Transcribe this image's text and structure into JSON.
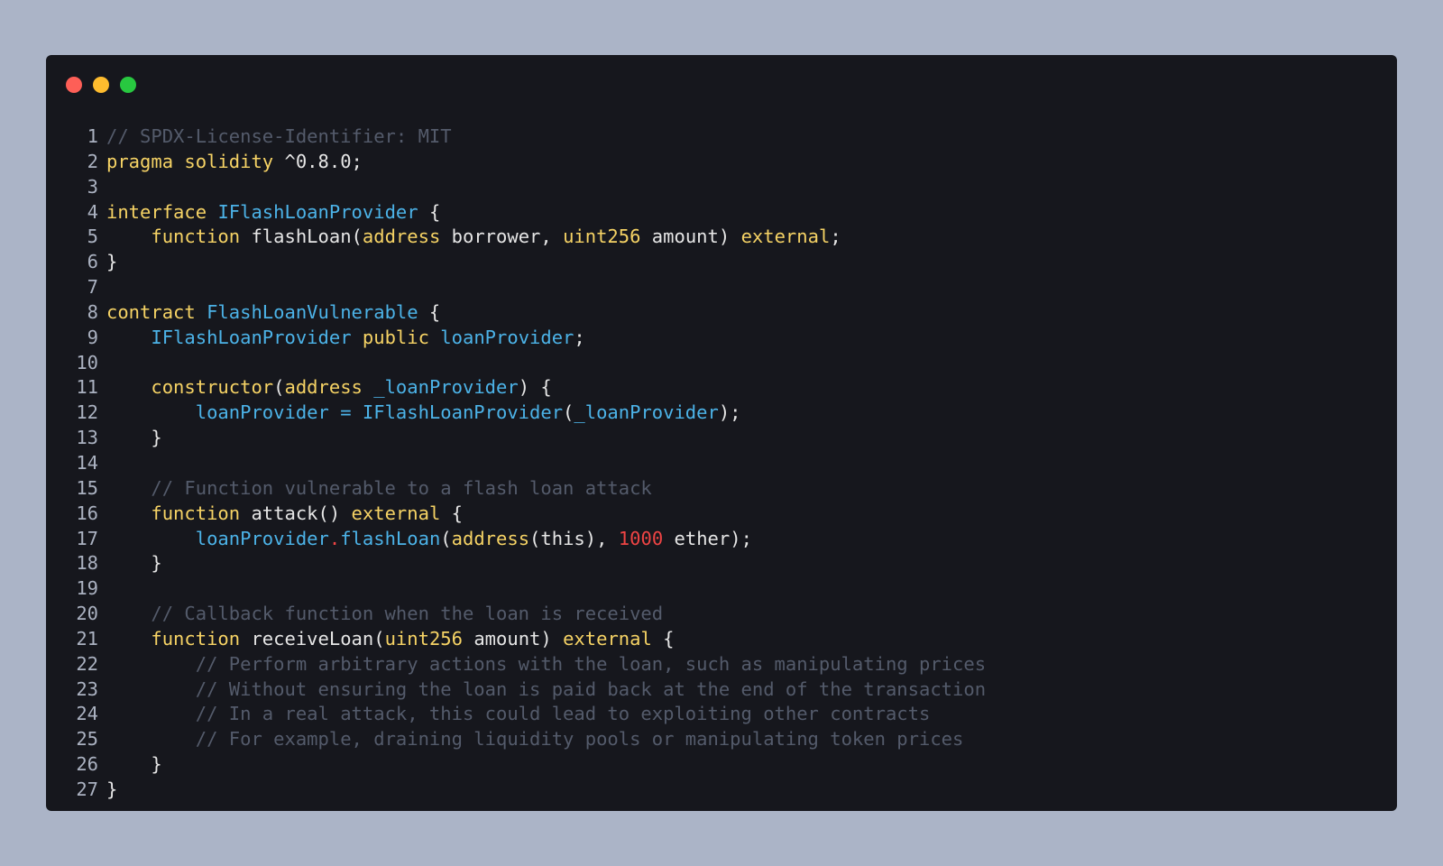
{
  "window": {
    "dots": [
      {
        "name": "close-dot",
        "color": "#fe5f57"
      },
      {
        "name": "minimize-dot",
        "color": "#febc2e"
      },
      {
        "name": "maximize-dot",
        "color": "#28c840"
      }
    ]
  },
  "colors": {
    "background": "#abb4c7",
    "editor_bg": "#16171d",
    "line_number": "#aab1c0",
    "plain": "#e6e6e6",
    "keyword": "#f6d365",
    "type": "#4cb3e8",
    "comment": "#545b6b",
    "number": "#ef4444"
  },
  "code": {
    "language": "solidity",
    "lines": [
      {
        "n": "1",
        "tokens": [
          {
            "t": "comment",
            "v": "// SPDX-License-Identifier: MIT"
          }
        ]
      },
      {
        "n": "2",
        "tokens": [
          {
            "t": "kw",
            "v": "pragma"
          },
          {
            "t": "plain",
            "v": " "
          },
          {
            "t": "kw",
            "v": "solidity"
          },
          {
            "t": "plain",
            "v": " ^0.8.0;"
          }
        ]
      },
      {
        "n": "3",
        "tokens": []
      },
      {
        "n": "4",
        "tokens": [
          {
            "t": "kw",
            "v": "interface"
          },
          {
            "t": "plain",
            "v": " "
          },
          {
            "t": "type",
            "v": "IFlashLoanProvider"
          },
          {
            "t": "plain",
            "v": " {"
          }
        ]
      },
      {
        "n": "5",
        "tokens": [
          {
            "t": "plain",
            "v": "    "
          },
          {
            "t": "kw",
            "v": "function"
          },
          {
            "t": "plain",
            "v": " flashLoan("
          },
          {
            "t": "kw",
            "v": "address"
          },
          {
            "t": "plain",
            "v": " borrower, "
          },
          {
            "t": "kw",
            "v": "uint256"
          },
          {
            "t": "plain",
            "v": " amount) "
          },
          {
            "t": "kw",
            "v": "external"
          },
          {
            "t": "plain",
            "v": ";"
          }
        ]
      },
      {
        "n": "6",
        "tokens": [
          {
            "t": "plain",
            "v": "}"
          }
        ]
      },
      {
        "n": "7",
        "tokens": []
      },
      {
        "n": "8",
        "tokens": [
          {
            "t": "kw",
            "v": "contract"
          },
          {
            "t": "plain",
            "v": " "
          },
          {
            "t": "type",
            "v": "FlashLoanVulnerable"
          },
          {
            "t": "plain",
            "v": " {"
          }
        ]
      },
      {
        "n": "9",
        "tokens": [
          {
            "t": "plain",
            "v": "    "
          },
          {
            "t": "type",
            "v": "IFlashLoanProvider"
          },
          {
            "t": "plain",
            "v": " "
          },
          {
            "t": "kw",
            "v": "public"
          },
          {
            "t": "plain",
            "v": " "
          },
          {
            "t": "type",
            "v": "loanProvider"
          },
          {
            "t": "plain",
            "v": ";"
          }
        ]
      },
      {
        "n": "10",
        "tokens": []
      },
      {
        "n": "11",
        "tokens": [
          {
            "t": "plain",
            "v": "    "
          },
          {
            "t": "kw",
            "v": "constructor"
          },
          {
            "t": "plain",
            "v": "("
          },
          {
            "t": "kw",
            "v": "address"
          },
          {
            "t": "plain",
            "v": " "
          },
          {
            "t": "type",
            "v": "_loanProvider"
          },
          {
            "t": "plain",
            "v": ") {"
          }
        ]
      },
      {
        "n": "12",
        "tokens": [
          {
            "t": "plain",
            "v": "        "
          },
          {
            "t": "type",
            "v": "loanProvider = IFlashLoanProvider"
          },
          {
            "t": "plain",
            "v": "("
          },
          {
            "t": "type",
            "v": "_loanProvider"
          },
          {
            "t": "plain",
            "v": ");"
          }
        ]
      },
      {
        "n": "13",
        "tokens": [
          {
            "t": "plain",
            "v": "    }"
          }
        ]
      },
      {
        "n": "14",
        "tokens": []
      },
      {
        "n": "15",
        "tokens": [
          {
            "t": "plain",
            "v": "    "
          },
          {
            "t": "comment",
            "v": "// Function vulnerable to a flash loan attack"
          }
        ]
      },
      {
        "n": "16",
        "tokens": [
          {
            "t": "plain",
            "v": "    "
          },
          {
            "t": "kw",
            "v": "function"
          },
          {
            "t": "plain",
            "v": " attack() "
          },
          {
            "t": "kw",
            "v": "external"
          },
          {
            "t": "plain",
            "v": " {"
          }
        ]
      },
      {
        "n": "17",
        "tokens": [
          {
            "t": "plain",
            "v": "        "
          },
          {
            "t": "type",
            "v": "loanProvider"
          },
          {
            "t": "dot",
            "v": "."
          },
          {
            "t": "type",
            "v": "flashLoan"
          },
          {
            "t": "plain",
            "v": "("
          },
          {
            "t": "kw",
            "v": "address"
          },
          {
            "t": "plain",
            "v": "(this), "
          },
          {
            "t": "num",
            "v": "1000"
          },
          {
            "t": "plain",
            "v": " ether);"
          }
        ]
      },
      {
        "n": "18",
        "tokens": [
          {
            "t": "plain",
            "v": "    }"
          }
        ]
      },
      {
        "n": "19",
        "tokens": []
      },
      {
        "n": "20",
        "tokens": [
          {
            "t": "plain",
            "v": "    "
          },
          {
            "t": "comment",
            "v": "// Callback function when the loan is received"
          }
        ]
      },
      {
        "n": "21",
        "tokens": [
          {
            "t": "plain",
            "v": "    "
          },
          {
            "t": "kw",
            "v": "function"
          },
          {
            "t": "plain",
            "v": " receiveLoan("
          },
          {
            "t": "kw",
            "v": "uint256"
          },
          {
            "t": "plain",
            "v": " amount) "
          },
          {
            "t": "kw",
            "v": "external"
          },
          {
            "t": "plain",
            "v": " {"
          }
        ]
      },
      {
        "n": "22",
        "tokens": [
          {
            "t": "plain",
            "v": "        "
          },
          {
            "t": "comment",
            "v": "// Perform arbitrary actions with the loan, such as manipulating prices"
          }
        ]
      },
      {
        "n": "23",
        "tokens": [
          {
            "t": "plain",
            "v": "        "
          },
          {
            "t": "comment",
            "v": "// Without ensuring the loan is paid back at the end of the transaction"
          }
        ]
      },
      {
        "n": "24",
        "tokens": [
          {
            "t": "plain",
            "v": "        "
          },
          {
            "t": "comment",
            "v": "// In a real attack, this could lead to exploiting other contracts"
          }
        ]
      },
      {
        "n": "25",
        "tokens": [
          {
            "t": "plain",
            "v": "        "
          },
          {
            "t": "comment",
            "v": "// For example, draining liquidity pools or manipulating token prices"
          }
        ]
      },
      {
        "n": "26",
        "tokens": [
          {
            "t": "plain",
            "v": "    }"
          }
        ]
      },
      {
        "n": "27",
        "tokens": [
          {
            "t": "plain",
            "v": "}"
          }
        ]
      }
    ]
  }
}
